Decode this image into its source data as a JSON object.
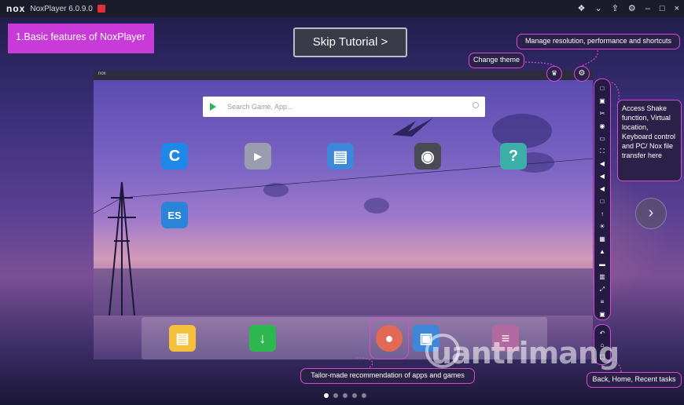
{
  "titlebar": {
    "logo": "nox",
    "version": "NoxPlayer 6.0.9.0",
    "controls": [
      "❖",
      "⌄",
      "⇪",
      "⚙",
      "–",
      "□",
      "×"
    ]
  },
  "tutorial": {
    "step_label": "1.Basic features of NoxPlayer",
    "skip_label": "Skip Tutorial >"
  },
  "callouts": {
    "resolution": "Manage resolution, performance and shortcuts",
    "theme": "Change theme",
    "shake": "Access Shake function, Virtual location, Keyboard control and PC/ Nox file transfer here",
    "tailor": "Tailor-made recommendation of apps and games",
    "back": "Back, Home, Recent tasks"
  },
  "emulator": {
    "logo": "nox",
    "search": {
      "placeholder": "Search Game, App..."
    },
    "apps": [
      {
        "name": "c-browser-icon",
        "glyph": "C",
        "color": "#1f88e6"
      },
      {
        "name": "launcher-icon",
        "glyph": "▶",
        "color": "#9a9cb0"
      },
      {
        "name": "contacts-icon",
        "glyph": "▤",
        "color": "#3d86d8"
      },
      {
        "name": "camera-icon",
        "glyph": "◉",
        "color": "#4a4a55"
      },
      {
        "name": "help-icon",
        "glyph": "?",
        "color": "#3cb0a8"
      },
      {
        "name": "es-file-icon",
        "glyph": "ES",
        "color": "#2a84d8"
      }
    ],
    "dock": [
      {
        "name": "folder-icon",
        "glyph": "▤",
        "color": "#f5c03b"
      },
      {
        "name": "download-icon",
        "glyph": "↓",
        "color": "#2db84f"
      },
      {
        "name": "app-center-icon",
        "glyph": "●",
        "color": "#e26a55"
      },
      {
        "name": "gallery-icon",
        "glyph": "▣",
        "color": "#3d86d8"
      },
      {
        "name": "settings-app-icon",
        "glyph": "≡",
        "color": "#b06aa0"
      }
    ]
  },
  "sidebar_icons": [
    "□",
    "▣",
    "✂",
    "◉",
    "▭",
    "⛶",
    "◀",
    "◀",
    "◀",
    "□",
    "↑",
    "☀",
    "▦",
    "▲",
    "▬",
    "▥",
    "⤢",
    "≡",
    "▣"
  ],
  "nav_icons": [
    "↶",
    "⌂",
    "▢"
  ],
  "theme_glyph": "♛",
  "settings_glyph": "⚙",
  "next_glyph": "›",
  "watermark": "uantrimang",
  "page_indicator": {
    "count": 5,
    "active": 0
  }
}
